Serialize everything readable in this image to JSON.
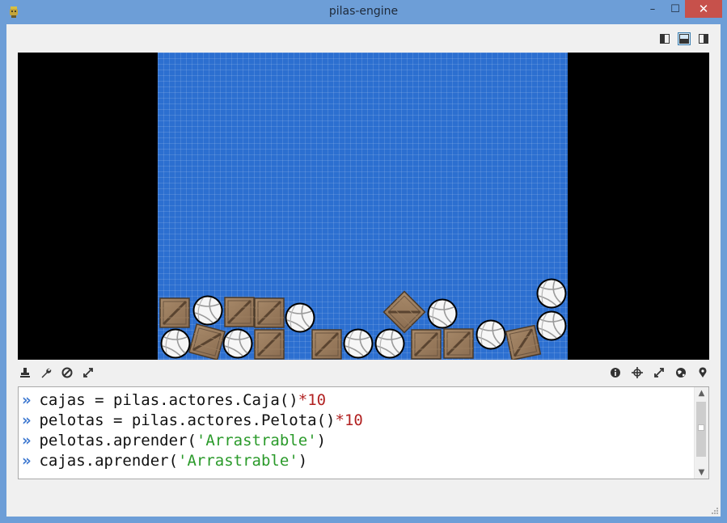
{
  "window": {
    "title": "pilas-engine",
    "minimize_glyph": "–",
    "maximize_glyph": "☐",
    "close_glyph": "✕"
  },
  "layout_buttons": [
    "layout-left-panel-icon",
    "layout-bottom-panel-icon",
    "layout-right-panel-icon"
  ],
  "toolbar": {
    "left_icons": [
      "stamp-icon",
      "wrench-icon",
      "no-icon",
      "expand-icon"
    ],
    "right_icons": [
      "info-icon",
      "crosshair-icon",
      "fullscreen-icon",
      "globe-icon",
      "location-pin-icon"
    ]
  },
  "console": {
    "prompt": "»",
    "lines": [
      {
        "code": "cajas = pilas.actores.Caja()",
        "num": "*10",
        "str": "",
        "tail": ""
      },
      {
        "code": "pelotas = pilas.actores.Pelota()",
        "num": "*10",
        "str": "",
        "tail": ""
      },
      {
        "code": "pelotas.aprender(",
        "num": "",
        "str": "'Arrastrable'",
        "tail": ")"
      },
      {
        "code": "cajas.aprender(",
        "num": "",
        "str": "'Arrastrable'",
        "tail": ")"
      }
    ]
  },
  "colors": {
    "titlebar": "#6d9ed7",
    "close_button": "#c7514b",
    "canvas_blue": "#2c6fd0",
    "prompt": "#3d78d0",
    "number": "#b22222",
    "string": "#2a9a2a"
  }
}
